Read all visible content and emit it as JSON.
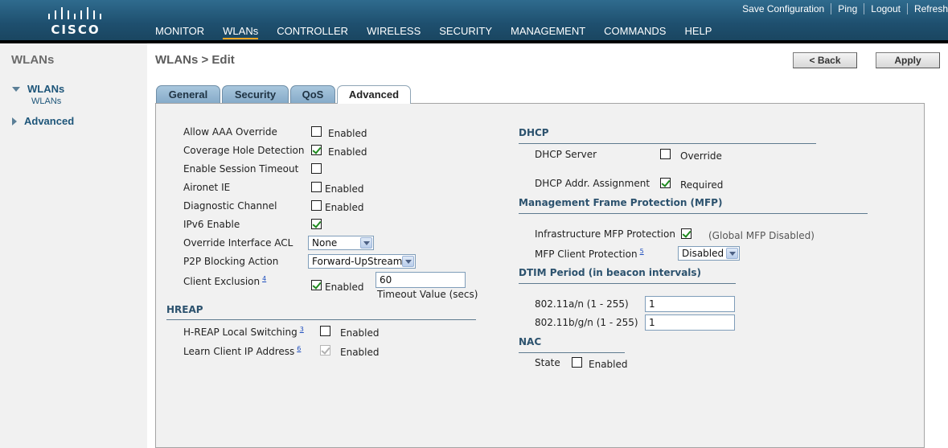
{
  "header": {
    "brand": "CISCO",
    "links": [
      "Save Configuration",
      "Ping",
      "Logout",
      "Refresh"
    ],
    "nav": [
      "MONITOR",
      "WLANs",
      "CONTROLLER",
      "WIRELESS",
      "SECURITY",
      "MANAGEMENT",
      "COMMANDS",
      "HELP"
    ],
    "active_nav": "WLANs"
  },
  "sidebar": {
    "title": "WLANs",
    "items": [
      {
        "label": "WLANs",
        "expanded": true,
        "sub": [
          "WLANs"
        ]
      },
      {
        "label": "Advanced",
        "expanded": false
      }
    ]
  },
  "page": {
    "title": "WLANs > Edit",
    "back_label": "< Back",
    "apply_label": "Apply"
  },
  "tabs": [
    "General",
    "Security",
    "QoS",
    "Advanced"
  ],
  "active_tab": "Advanced",
  "left": {
    "allow_aaa": {
      "label": "Allow AAA Override",
      "checked": false,
      "text": "Enabled"
    },
    "coverage_hole": {
      "label": "Coverage Hole Detection",
      "checked": true,
      "text": "Enabled"
    },
    "session_timeout": {
      "label": "Enable Session Timeout",
      "checked": false
    },
    "aironet_ie": {
      "label": "Aironet IE",
      "checked": false,
      "text": "Enabled"
    },
    "diag_channel": {
      "label": "Diagnostic Channel",
      "checked": false,
      "text": "Enabled"
    },
    "ipv6": {
      "label": "IPv6 Enable",
      "checked": true
    },
    "override_acl": {
      "label": "Override Interface ACL",
      "value": "None"
    },
    "p2p_blocking": {
      "label": "P2P Blocking Action",
      "value": "Forward-UpStream"
    },
    "client_exclusion": {
      "label": "Client Exclusion",
      "footnote": "4",
      "checked": true,
      "text": "Enabled",
      "timeout_value": "60",
      "timeout_label": "Timeout Value (secs)"
    },
    "hreap": {
      "heading": "HREAP",
      "local_switching": {
        "label": "H-REAP Local Switching",
        "footnote": "3",
        "checked": false,
        "text": "Enabled"
      },
      "learn_ip": {
        "label": "Learn Client IP Address",
        "footnote": "6",
        "checked": true,
        "disabled": true,
        "text": "Enabled"
      }
    }
  },
  "right": {
    "dhcp": {
      "heading": "DHCP",
      "server": {
        "label": "DHCP Server",
        "checked": false,
        "text": "Override"
      },
      "addr_assignment": {
        "label": "DHCP Addr. Assignment",
        "checked": true,
        "text": "Required"
      }
    },
    "mfp": {
      "heading": "Management Frame Protection (MFP)",
      "infrastructure": {
        "label": "Infrastructure MFP Protection",
        "checked": true,
        "note": "(Global MFP Disabled)"
      },
      "client": {
        "label": "MFP Client Protection",
        "footnote": "5",
        "value": "Disabled"
      }
    },
    "dtim": {
      "heading": "DTIM Period (in beacon intervals)",
      "a_n": {
        "label": "802.11a/n (1 - 255)",
        "value": "1"
      },
      "b_g_n": {
        "label": "802.11b/g/n (1 - 255)",
        "value": "1"
      }
    },
    "nac": {
      "heading": "NAC",
      "state": {
        "label": "State",
        "checked": false,
        "text": "Enabled"
      }
    }
  },
  "colors": {
    "header": "#1e4f6e",
    "tab": "#86abc9",
    "panel": "#f1f1f1",
    "heading": "#2c526e"
  }
}
